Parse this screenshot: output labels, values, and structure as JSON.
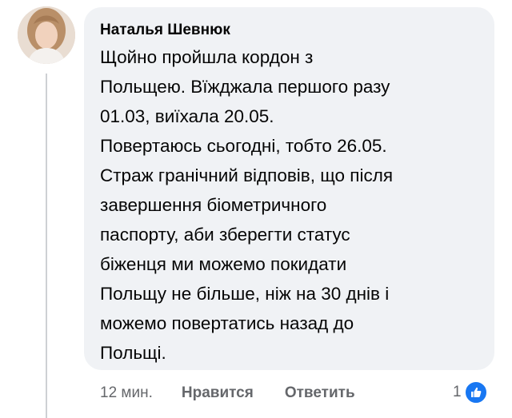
{
  "comment": {
    "author": "Наталья Шевнюк",
    "text_lines": [
      "Щойно пройшла кордон з",
      "Польщею. Вїжджала першого разу",
      "01.03, виїхала 20.05.",
      "Повертаюсь сьогодні, тобто 26.05.",
      "Страж гранічний відповів, що після",
      "завершення біометричного",
      "паспорту, аби зберегти статус",
      "біженця ми можемо покидати",
      "Польщу не більше, ніж на 30 днів і",
      "можемо повертатись назад до",
      "Польщі."
    ]
  },
  "actions": {
    "timestamp": "12 мин.",
    "like_label": "Нравится",
    "reply_label": "Ответить"
  },
  "reactions": {
    "count": "1",
    "icon": "thumbs-up-icon"
  },
  "colors": {
    "bubble_bg": "#f0f2f5",
    "text": "#050505",
    "secondary_text": "#65676b",
    "like_blue": "#1877f2"
  }
}
